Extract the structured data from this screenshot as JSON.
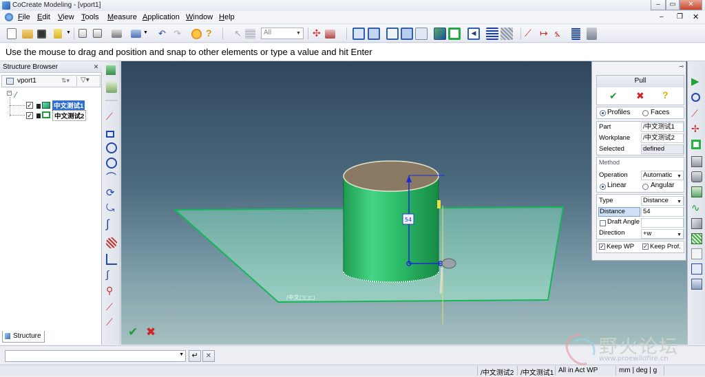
{
  "window": {
    "title": "CoCreate Modeling - [vport1]"
  },
  "menu": {
    "items": [
      {
        "label": "File",
        "underline": "F"
      },
      {
        "label": "Edit",
        "underline": "E"
      },
      {
        "label": "View",
        "underline": "V"
      },
      {
        "label": "Tools",
        "underline": "T"
      },
      {
        "label": "Measure",
        "underline": "M"
      },
      {
        "label": "Application",
        "underline": "A"
      },
      {
        "label": "Window",
        "underline": "W"
      },
      {
        "label": "Help",
        "underline": "H"
      }
    ]
  },
  "toolbar": {
    "filter_value": "All"
  },
  "prompt": {
    "text": "Use the mouse to drag and position and snap to other elements or type a value and hit Enter"
  },
  "structure_browser": {
    "title": "Structure Browser",
    "root": "vport1",
    "items": [
      {
        "label": "中文测试1",
        "checked": true,
        "selected": true
      },
      {
        "label": "中文测试2",
        "checked": true,
        "selected": false
      }
    ],
    "tab": "Structure"
  },
  "viewport": {
    "dimension_label": "54",
    "plane_label": "/中文□□□",
    "colors": {
      "part": "#2fbf6a",
      "top_face": "#8c7a60",
      "plane": "#6fc6b2",
      "dimension": "#1a2bd6"
    }
  },
  "pull_panel": {
    "title": "Pull",
    "mode_profiles": "Profiles",
    "mode_faces": "Faces",
    "part_label": "Part",
    "part_value": "/中文测试1",
    "workplane_label": "Workplane",
    "workplane_value": "/中文测试2",
    "selected_label": "Selected",
    "selected_value": "defined",
    "method_heading": "Method",
    "operation_label": "Operation",
    "operation_value": "Automatic",
    "linear_label": "Linear",
    "angular_label": "Angular",
    "type_label": "Type",
    "type_value": "Distance",
    "distance_label": "Distance",
    "distance_value": "54",
    "draft_angle_label": "Draft Angle",
    "direction_label": "Direction",
    "direction_value": "+w",
    "keep_wp_label": "Keep WP",
    "keep_prof_label": "Keep Prof."
  },
  "statusbar": {
    "part": "/中文测试2",
    "workplane": "/中文测试1",
    "filter": "All in Act WP",
    "units": "mm | deg | g"
  },
  "watermark": {
    "text": "野火论坛",
    "url": "www.proewildfire.cn"
  }
}
